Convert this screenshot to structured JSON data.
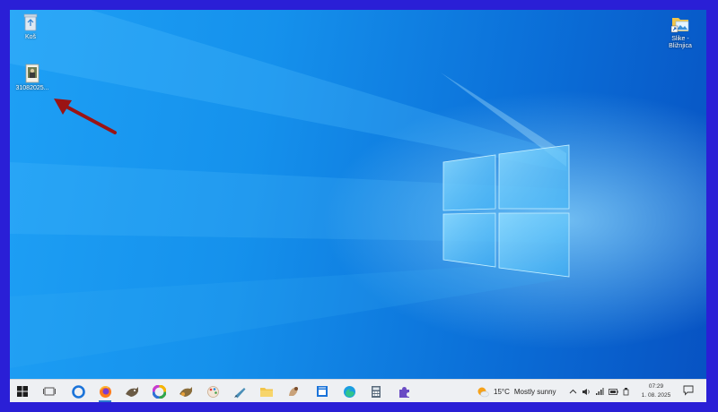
{
  "desktop": {
    "icons": [
      {
        "label": "Koš",
        "icon": "recycle-bin-icon"
      },
      {
        "label": "31082025...",
        "icon": "image-file-icon"
      },
      {
        "label_line1": "Slike -",
        "label_line2": "Bližnjica",
        "icon": "pictures-shortcut-icon"
      }
    ],
    "annotation": {
      "icon": "red-arrow-annotation",
      "color": "#9b1414"
    }
  },
  "taskbar": {
    "apps": [
      {
        "name": "start-icon"
      },
      {
        "name": "task-view-icon"
      },
      {
        "name": "cortana-icon"
      },
      {
        "name": "firefox-icon",
        "active": true
      },
      {
        "name": "gimp-icon"
      },
      {
        "name": "color-wheel-icon"
      },
      {
        "name": "gimp-alt-icon"
      },
      {
        "name": "paint-icon"
      },
      {
        "name": "draw-icon"
      },
      {
        "name": "file-explorer-icon"
      },
      {
        "name": "image-viewer-icon"
      },
      {
        "name": "calendar-app-icon"
      },
      {
        "name": "edge-icon"
      },
      {
        "name": "calculator-icon"
      },
      {
        "name": "puzzle-app-icon"
      }
    ],
    "weather": {
      "temp": "15°C",
      "condition": "Mostly sunny",
      "icon": "sun-cloud-icon"
    },
    "tray": [
      "chevron-up-icon",
      "speaker-icon",
      "network-icon",
      "battery-icon",
      "usb-icon"
    ],
    "clock": {
      "time": "07:29",
      "date": "1. 08. 2025"
    },
    "notification_icon": "notification-icon"
  },
  "colors": {
    "frame": "#2a1fd6",
    "accent": "#1591ec",
    "arrow": "#9b1414"
  }
}
